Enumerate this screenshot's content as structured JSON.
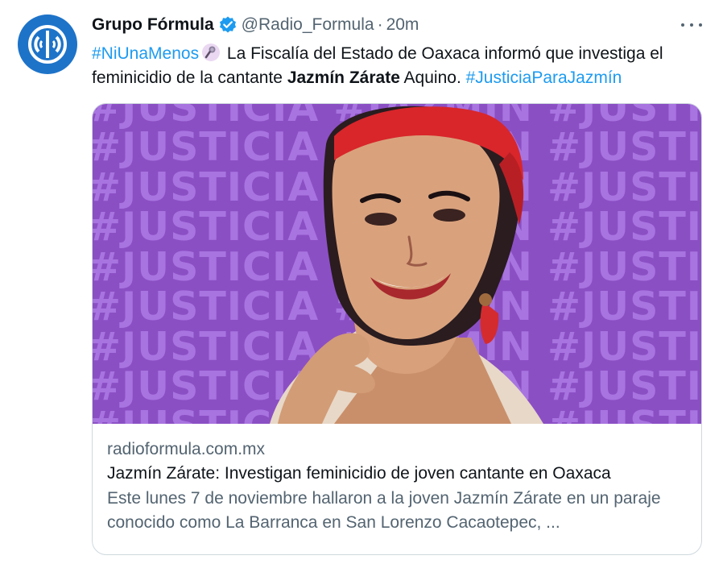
{
  "tweet": {
    "avatar_label": "Grupo Fórmula logo",
    "display_name": "Grupo Fórmula",
    "handle": "@Radio_Formula",
    "separator": "·",
    "time": "20m",
    "text": {
      "hashtag1": "#NiUnaMenos",
      "part1": " La Fiscalía del Estado de Oaxaca informó que investiga el feminicidio de la cantante ",
      "bold_name": "Jazmín Zárate",
      "part2": " Aquino. ",
      "hashtag2": "#JusticiaParaJazmín"
    },
    "icons": {
      "verified": "verified-badge-icon",
      "more": "more-options-icon",
      "emoji": "microphone-emoji-icon"
    }
  },
  "card": {
    "background_repeated_text": "#JUSTICIA #JAZMIN",
    "domain": "radioformula.com.mx",
    "title": "Jazmín Zárate: Investigan feminicidio de joven cantante en Oaxaca",
    "description": "Este lunes 7 de noviembre hallaron a la joven Jazmín Zárate en un paraje conocido como La Barranca en San Lorenzo Cacaotepec, ..."
  },
  "colors": {
    "link": "#1d9bf0",
    "muted": "#536471",
    "text": "#0f1419",
    "purple_bg": "#8b4fc4",
    "purple_text": "#a874e0",
    "avatar": "#1d73c8",
    "border": "#cfd9de"
  }
}
